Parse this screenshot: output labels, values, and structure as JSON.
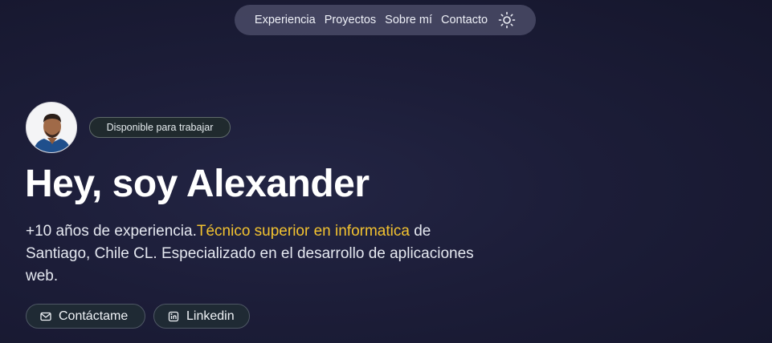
{
  "nav": {
    "items": [
      "Experiencia",
      "Proyectos",
      "Sobre mí",
      "Contacto"
    ],
    "theme_toggle_icon": "sun-icon"
  },
  "hero": {
    "avatar_icon": "person-avatar",
    "badge": "Disponible para trabajar",
    "title": "Hey, soy Alexander",
    "description_pre": "+10 años de experiencia.",
    "description_highlight": "Técnico superior en informatica",
    "description_post": " de Santiago, Chile CL. Especializado en el desarrollo de aplicaciones web."
  },
  "actions": {
    "contact_label": "Contáctame",
    "contact_icon": "mail-icon",
    "linkedin_label": "Linkedin",
    "linkedin_icon": "linkedin-icon"
  },
  "colors": {
    "background": "#1c1d38",
    "highlight": "#f2c230",
    "nav_bg": "#50526e"
  }
}
